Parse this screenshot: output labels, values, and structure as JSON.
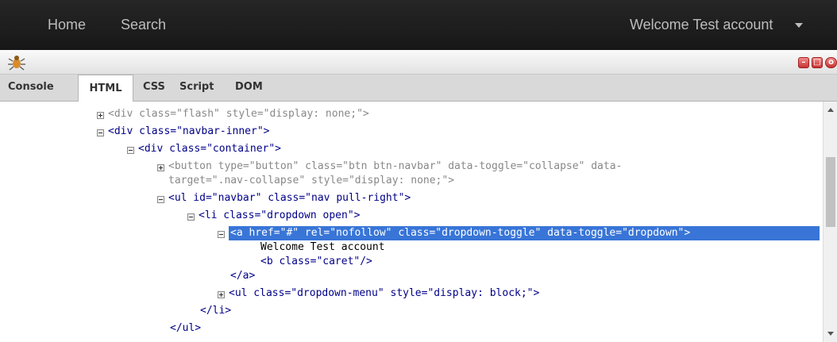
{
  "navbar": {
    "home": "Home",
    "search": "Search",
    "welcome": "Welcome Test account"
  },
  "firebug": {
    "tabs": [
      "Console",
      "HTML",
      "CSS",
      "Script",
      "DOM"
    ],
    "window_buttons": [
      "minimize",
      "restore",
      "close"
    ]
  },
  "tree": {
    "lines": [
      {
        "text": "<div class=\"flash\" style=\"display: none;\">"
      },
      {
        "text": "<div class=\"navbar-inner\">"
      },
      {
        "text": "<div class=\"container\">"
      },
      {
        "text": "<button type=\"button\" class=\"btn btn-navbar\" data-toggle=\"collapse\" data-"
      },
      {
        "text": "target=\".nav-collapse\" style=\"display: none;\">"
      },
      {
        "text": "<ul id=\"navbar\" class=\"nav pull-right\">"
      },
      {
        "text": "<li class=\"dropdown open\">"
      },
      {
        "text": "<a href=\"#\" rel=\"nofollow\" class=\"dropdown-toggle\" data-toggle=\"dropdown\">"
      },
      {
        "text": "Welcome Test account"
      },
      {
        "text": "<b class=\"caret\"/>"
      },
      {
        "text": "</a>"
      },
      {
        "text": "<ul class=\"dropdown-menu\" style=\"display: block;\">"
      },
      {
        "text": "</li>"
      },
      {
        "text": "</ul>"
      }
    ]
  },
  "colors": {
    "navbar_bg": "#1d1d1d",
    "selection": "#3875d7",
    "tag": "#000088",
    "attr_value": "#880000"
  }
}
